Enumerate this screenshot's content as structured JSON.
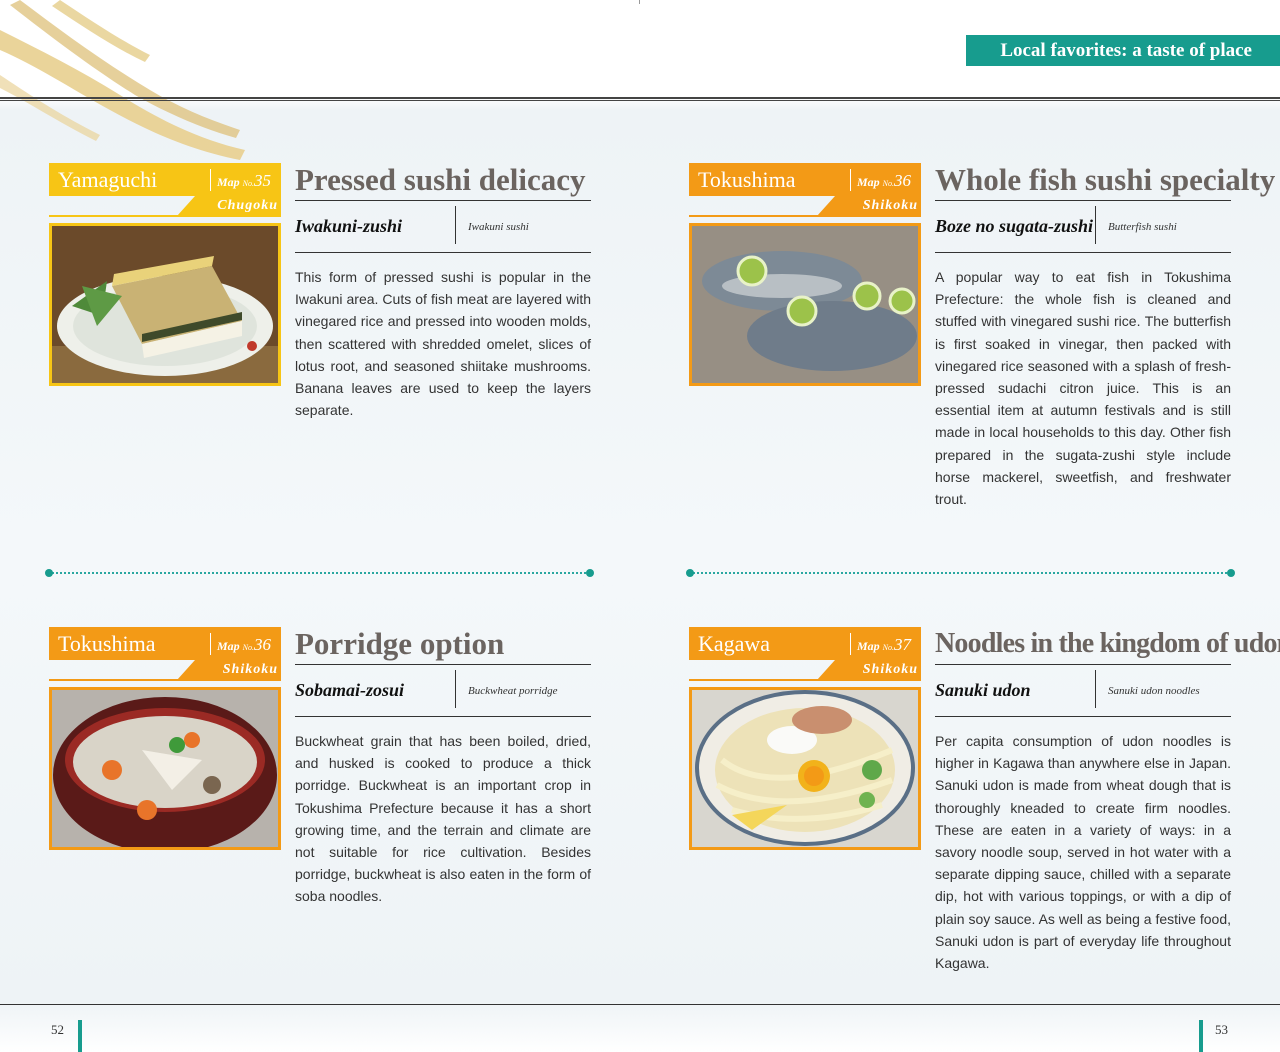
{
  "header": {
    "section_title": "Local favorites: a taste of place"
  },
  "colors": {
    "teal": "#179c8e",
    "orange": "#f39a16",
    "yellow": "#f7c515"
  },
  "cards": [
    {
      "prefecture": "Yamaguchi",
      "map_label": "Map",
      "map_no_label": "No.",
      "map_number": "35",
      "region": "Chugoku",
      "title": "Pressed sushi delicacy",
      "dish_name": "Iwakuni-zushi",
      "dish_english": "Iwakuni sushi",
      "body": "This form of pressed sushi is popular in the Iwakuni area. Cuts of fish meat are layered with vinegared rice and pressed into wooden molds, then scattered with shredded omelet, slices of lotus root, and seasoned shiitake mushrooms. Banana leaves are used to keep the layers separate.",
      "photo_icon": "pressed-sushi-photo"
    },
    {
      "prefecture": "Tokushima",
      "map_label": "Map",
      "map_no_label": "No.",
      "map_number": "36",
      "region": "Shikoku",
      "title": "Whole fish sushi specialty",
      "dish_name": "Boze no sugata-zushi",
      "dish_english": "Butterfish sushi",
      "body": "A popular way to eat fish in Tokushima Prefecture: the whole fish is cleaned and stuffed with vinegared sushi rice. The butterfish is first soaked in vinegar, then packed with vinegared rice seasoned with a splash of fresh-pressed sudachi citron juice. This is an essential item at autumn festivals and is still made in local households to this day. Other fish prepared in the sugata-zushi style include horse mackerel, sweetfish, and freshwater trout.",
      "photo_icon": "butterfish-sushi-photo"
    },
    {
      "prefecture": "Tokushima",
      "map_label": "Map",
      "map_no_label": "No.",
      "map_number": "36",
      "region": "Shikoku",
      "title": "Porridge option",
      "dish_name": "Sobamai-zosui",
      "dish_english": "Buckwheat porridge",
      "body": "Buckwheat grain that has been boiled, dried, and husked is cooked to produce a thick porridge. Buckwheat is an important crop in Tokushima Prefecture because it has a short growing time, and the terrain and climate are not suitable for rice cultivation. Besides porridge, buckwheat is also eaten in the form of soba noodles.",
      "photo_icon": "buckwheat-porridge-photo"
    },
    {
      "prefecture": "Kagawa",
      "map_label": "Map",
      "map_no_label": "No.",
      "map_number": "37",
      "region": "Shikoku",
      "title": "Noodles in the kingdom of udon",
      "dish_name": "Sanuki udon",
      "dish_english": "Sanuki udon noodles",
      "body": "Per capita consumption of udon noodles is higher in Kagawa than anywhere else in Japan. Sanuki udon is made from wheat dough that is thoroughly kneaded to create firm noodles. These are eaten in a variety of ways: in a savory noodle soup, served in hot water with a separate dipping sauce, chilled with a separate dip, hot with various toppings, or with a dip of plain soy sauce. As well as being a festive food, Sanuki udon is part of everyday life throughout Kagawa.",
      "photo_icon": "udon-noodles-photo"
    }
  ],
  "footer": {
    "page_left": "52",
    "page_right": "53"
  }
}
